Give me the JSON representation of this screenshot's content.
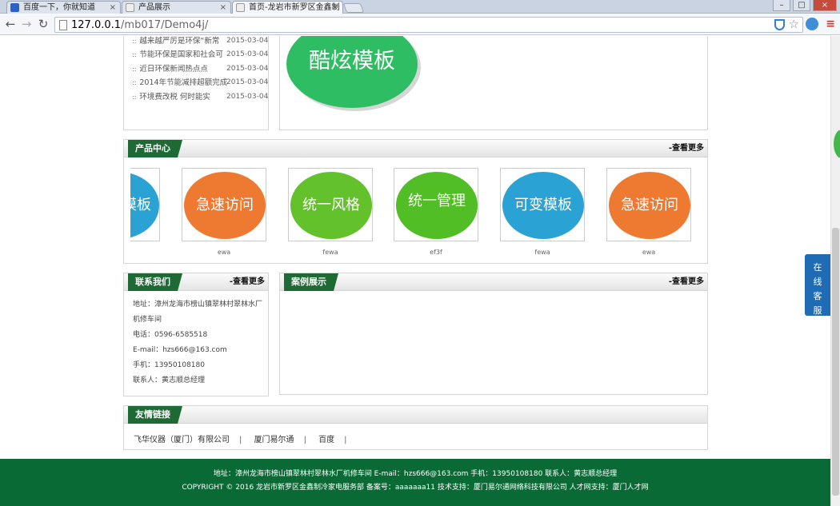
{
  "browser": {
    "tabs": [
      {
        "title": "百度一下，你就知道"
      },
      {
        "title": "产品展示"
      },
      {
        "title": "首页-龙岩市新罗区金鑫制"
      }
    ],
    "url_host": "127.0.0.1",
    "url_path": "/mb017/Demo4j/"
  },
  "news": {
    "items": [
      {
        "title": "越来越严厉是环保“新常",
        "date": "2015-03-04"
      },
      {
        "title": "节能环保是国家和社会可",
        "date": "2015-03-04"
      },
      {
        "title": "近日环保新闻热点点",
        "date": "2015-03-04"
      },
      {
        "title": "2014年节能减排超额完成",
        "date": "2015-03-04"
      },
      {
        "title": "环境费改税 何时能实",
        "date": "2015-03-04"
      }
    ]
  },
  "banner": {
    "text": "酷炫模板"
  },
  "products": {
    "title": "产品中心",
    "more": "-查看更多",
    "items": [
      {
        "label": "模板",
        "caption": "",
        "color": "#2aa2d3"
      },
      {
        "label": "急速访问",
        "caption": "ewa",
        "color": "#ee7a32"
      },
      {
        "label": "统一风格",
        "caption": "fewa",
        "color": "#63c12b"
      },
      {
        "label": "统一管理",
        "caption": "ef3f",
        "color": "#52be26"
      },
      {
        "label": "可变模板",
        "caption": "fewa",
        "color": "#2aa2d3"
      },
      {
        "label": "急速访问",
        "caption": "ewa",
        "color": "#ee7a32"
      }
    ]
  },
  "contact": {
    "title": "联系我们",
    "more": "-查看更多",
    "lines": [
      "地址：漳州龙海市榜山镇翠林村翠林水厂",
      "机修车间",
      "电话：0596-6585518",
      "E-mail：hzs666@163.com",
      "手机：13950108180",
      "联系人：黄志顺总经理"
    ]
  },
  "cases": {
    "title": "案例展示",
    "more": "-查看更多"
  },
  "friend_links": {
    "title": "友情链接",
    "items": [
      "飞华仪器（厦门）有限公司",
      "厦门易尔通",
      "百度"
    ]
  },
  "footer": {
    "line1": "地址：漳州龙海市榜山镇翠林村翠林水厂机修车间 E-mail：hzs666@163.com 手机：13950108180 联系人：黄志顺总经理",
    "line2": "COPYRIGHT © 2016 龙岩市新罗区金鑫制冷家电服务部 备案号：aaaaaaa11 技术支持：厦门易尔通网络科技有限公司 人才网支持：厦门人才网"
  },
  "service": {
    "label": "在线客服"
  }
}
